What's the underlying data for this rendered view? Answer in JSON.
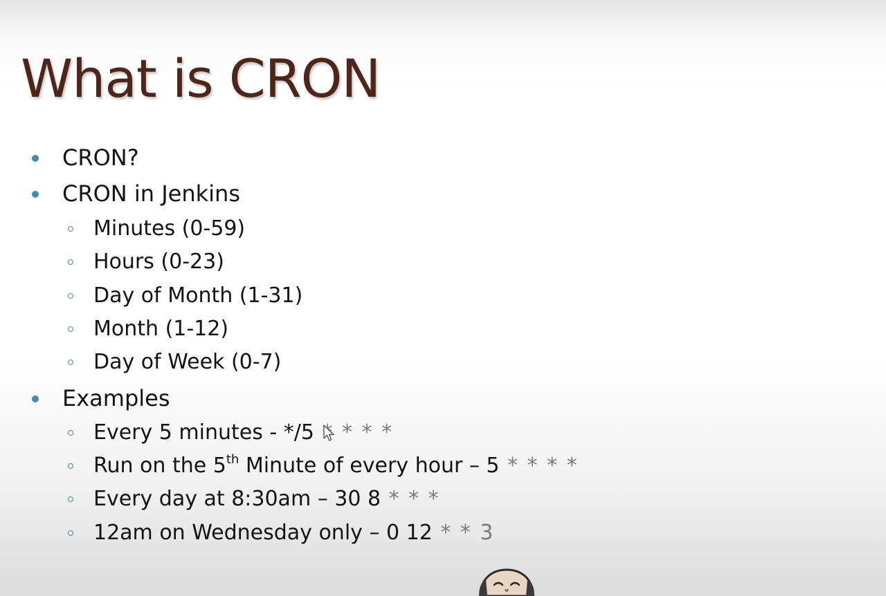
{
  "slide": {
    "title": "What is CRON",
    "bullets": [
      {
        "text": "CRON?"
      },
      {
        "text": "CRON in Jenkins"
      }
    ],
    "fields": [
      "Minutes (0-59)",
      "Hours (0-23)",
      "Day of Month (1-31)",
      "Month (1-12)",
      "Day of Week (0-7)"
    ],
    "examples_heading": "Examples",
    "examples": [
      {
        "label": "Every 5 minutes - ",
        "expr_dark": "*/5",
        "expr": " * * * *"
      },
      {
        "label_pre": "Run on the 5",
        "label_sup": "th",
        "label_post": " Minute of every hour – ",
        "expr_dark": "5",
        "expr": " * * * *"
      },
      {
        "label": "Every day at 8:30am – ",
        "expr_dark": "30 8",
        "expr": " * * *"
      },
      {
        "label": "12am on Wednesday only – ",
        "expr_dark": "0 12",
        "expr": " * * 3"
      }
    ]
  },
  "colors": {
    "title": "#4d2519",
    "bullet": "#3f8db0",
    "text": "#141414"
  },
  "icons": {
    "cursor": "mouse-pointer-icon",
    "mascot": "jenkins-mascot-icon"
  }
}
